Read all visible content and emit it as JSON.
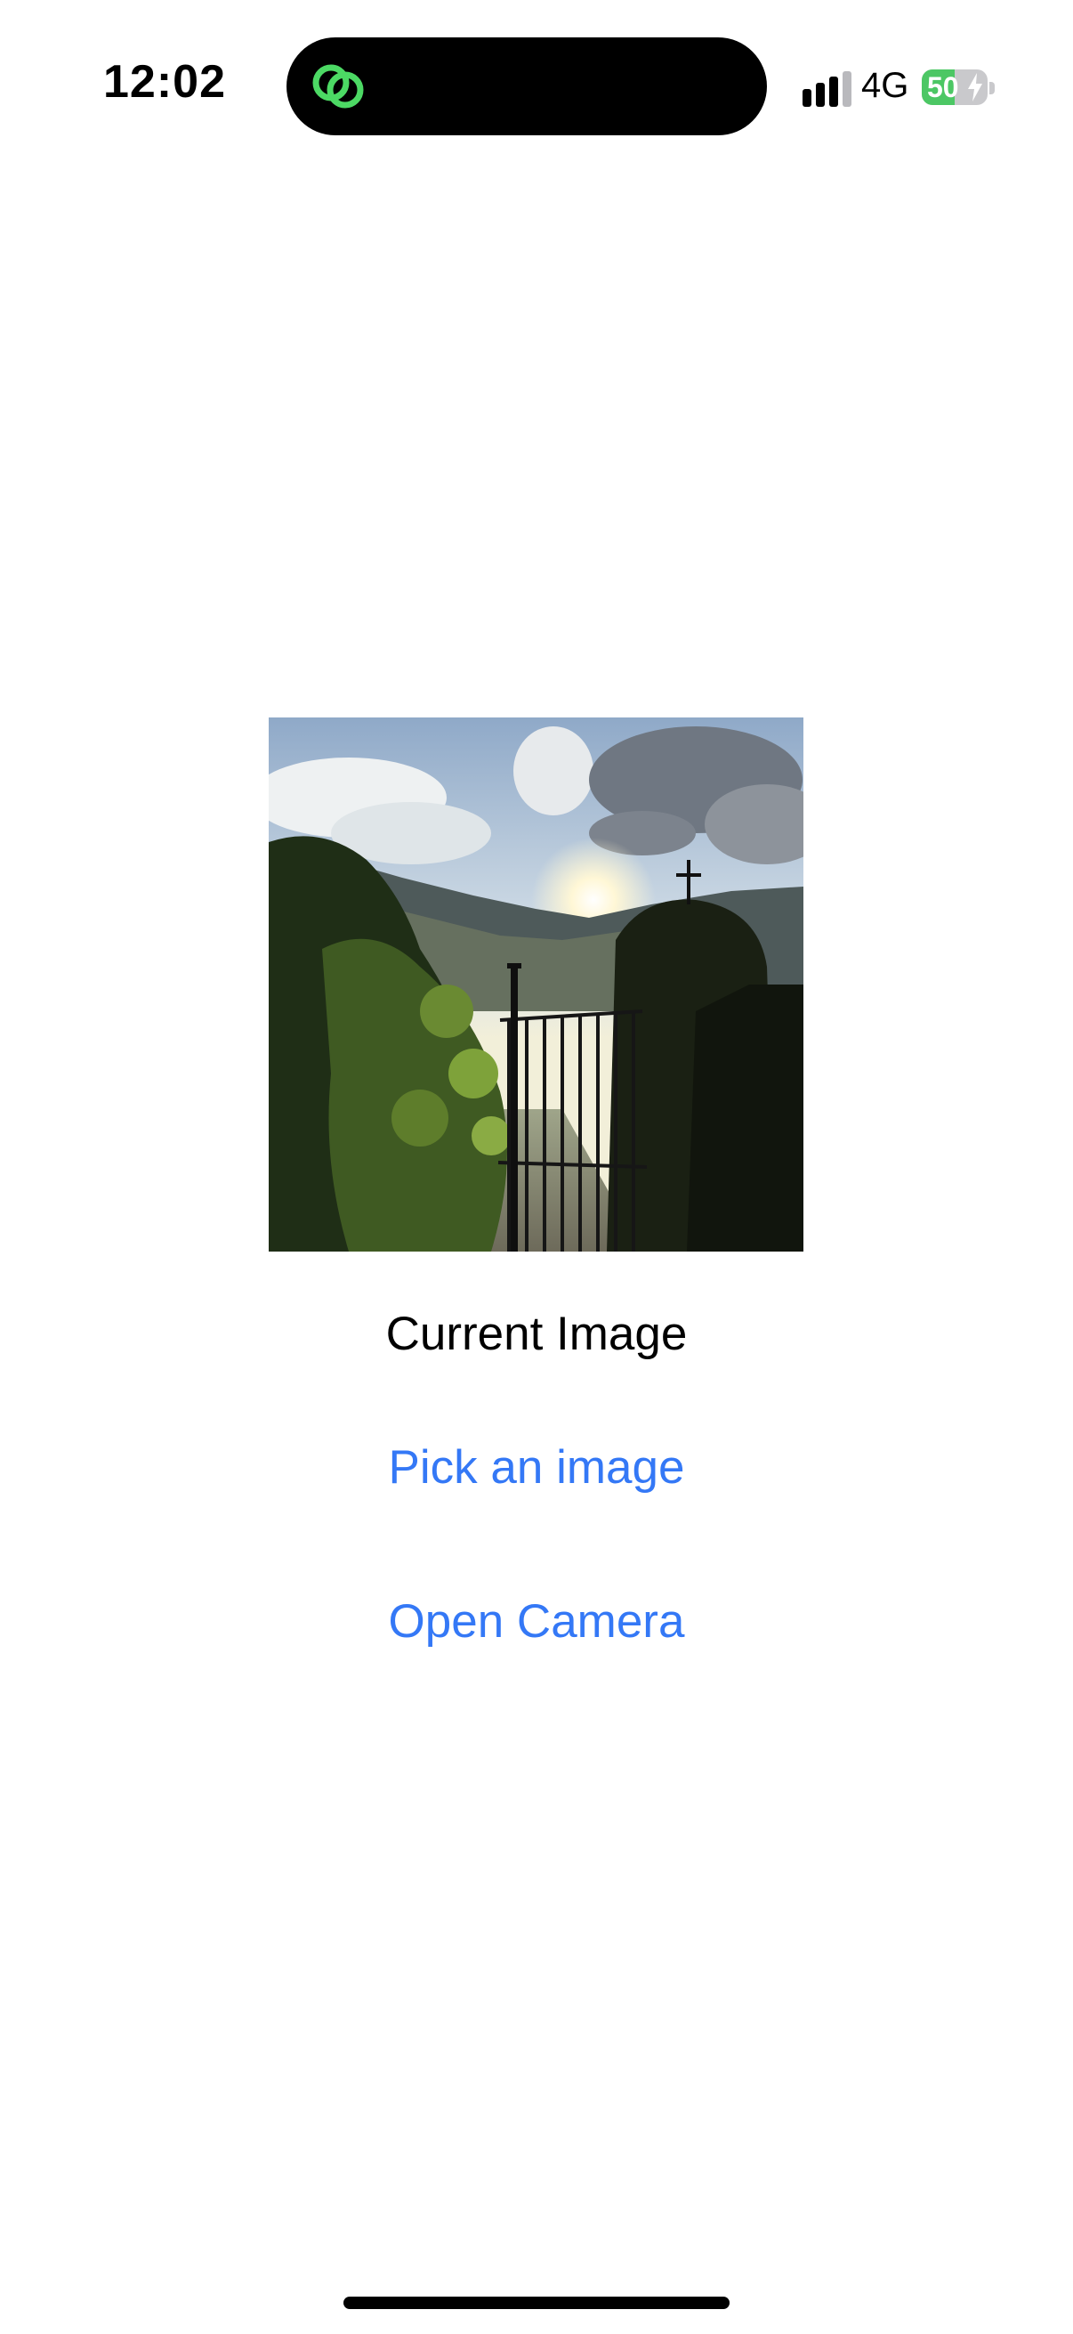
{
  "status_bar": {
    "time": "12:02",
    "network": "4G",
    "battery_percent": "50",
    "battery_level": 0.5,
    "island_icon": "linked-circles-icon",
    "accent_green": "#4cd964"
  },
  "main": {
    "image_description_icon": "photo-gate-sunset",
    "caption": "Current Image",
    "pick_image_label": "Pick an image",
    "open_camera_label": "Open Camera",
    "link_color": "#3478f6"
  }
}
